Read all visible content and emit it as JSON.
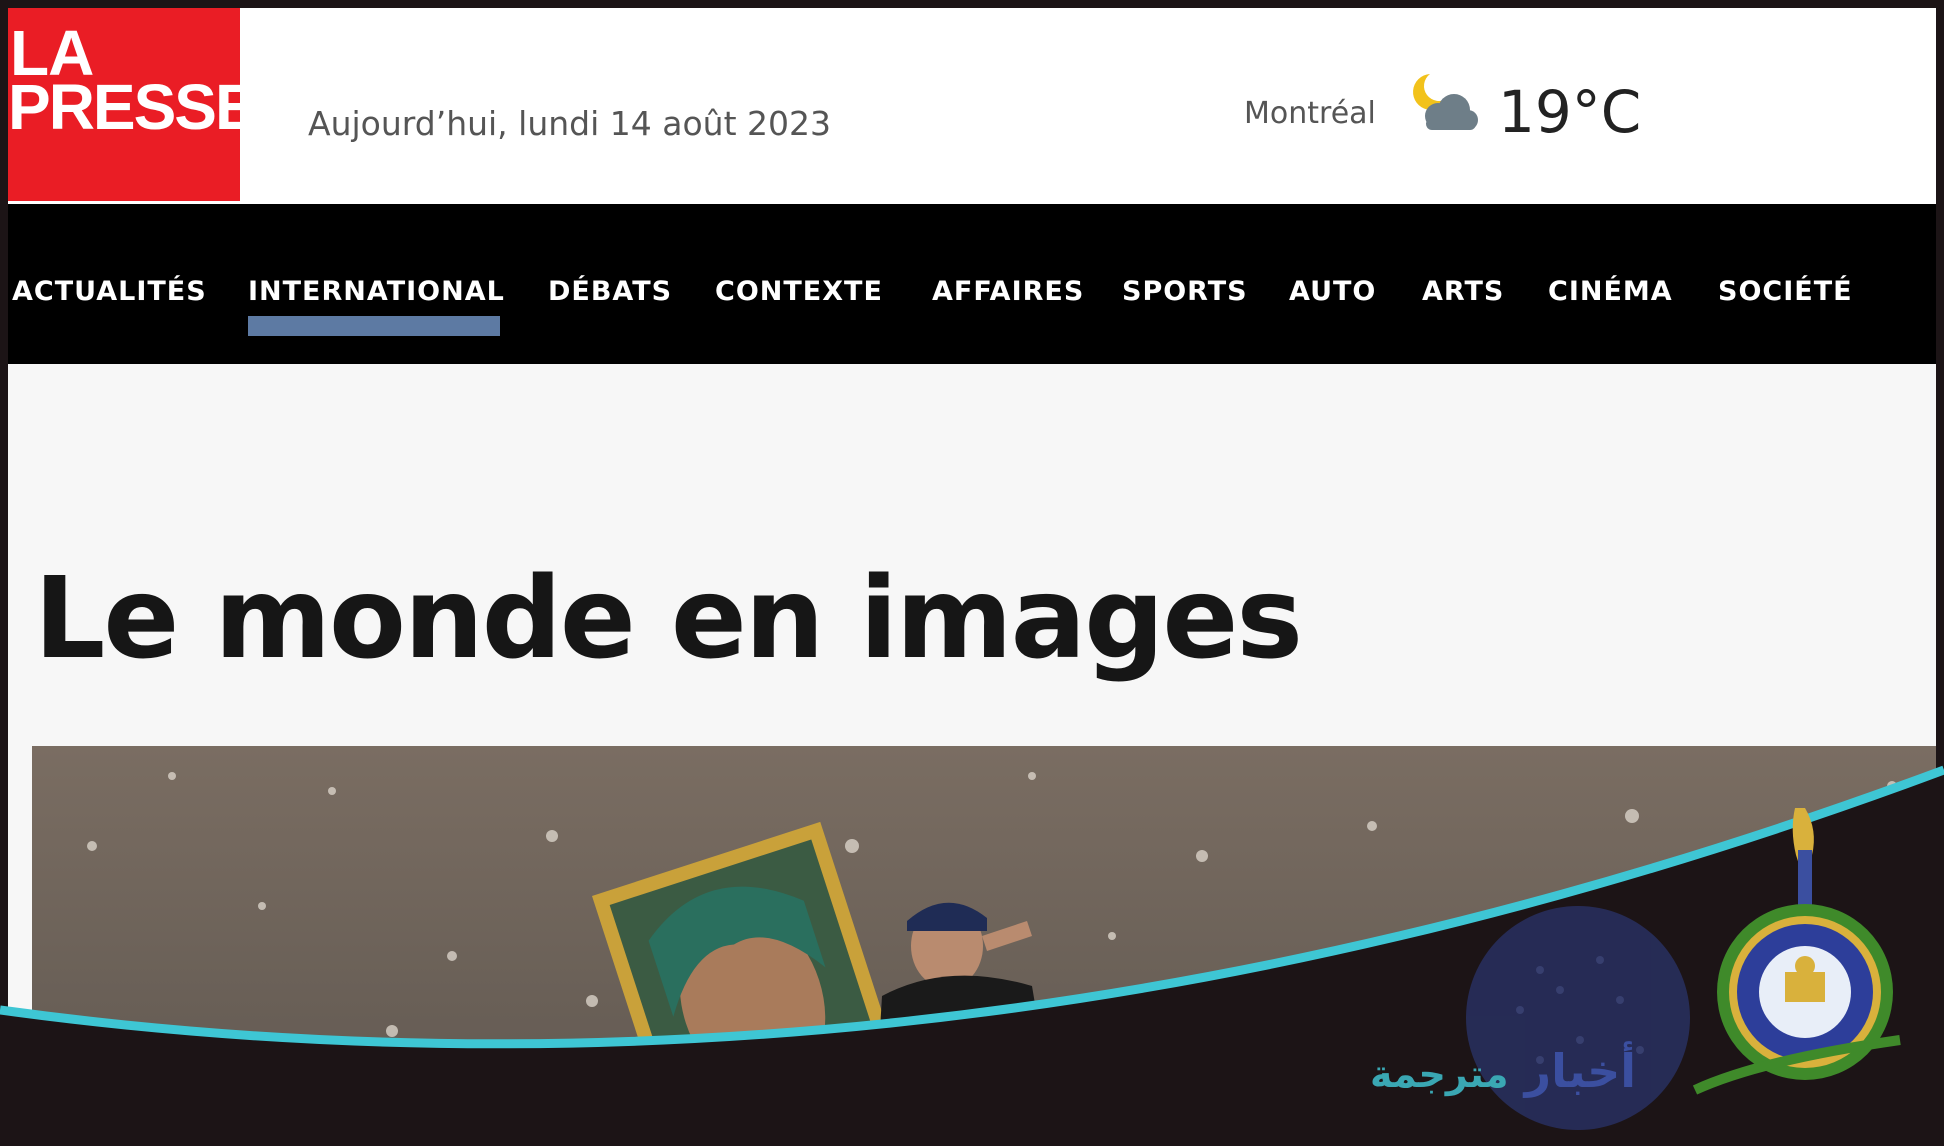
{
  "header": {
    "logo_line1": "LA",
    "logo_line2": "PRESSE",
    "date": "Aujourd’hui, lundi 14 août 2023",
    "city": "Montréal",
    "temperature": "19°C",
    "weather_icon": "moon-cloud-icon"
  },
  "nav": {
    "items": [
      {
        "label": "ACTUALITÉS"
      },
      {
        "label": "INTERNATIONAL"
      },
      {
        "label": "DÉBATS"
      },
      {
        "label": "CONTEXTE"
      },
      {
        "label": "AFFAIRES"
      },
      {
        "label": "SPORTS"
      },
      {
        "label": "AUTO"
      },
      {
        "label": "ARTS"
      },
      {
        "label": "CINÉMA"
      },
      {
        "label": "SOCIÉTÉ"
      }
    ],
    "active": "INTERNATIONAL"
  },
  "main": {
    "headline": "Le monde en images"
  },
  "overlay": {
    "news_word": "أخبار",
    "news_sub": "مترجمة",
    "accent": "#3ec6d4",
    "brand_green": "#3f8a2a"
  }
}
